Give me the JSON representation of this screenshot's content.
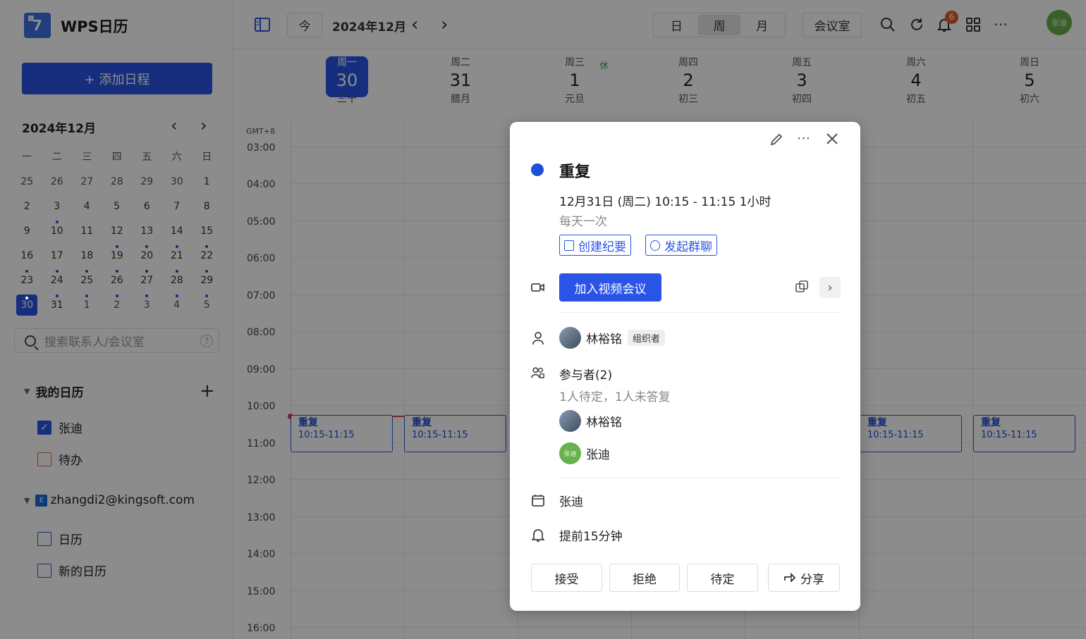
{
  "sidebar": {
    "app_title": "WPS日历",
    "logo_glyph": "7",
    "add_button": "+ 添加日程",
    "mini_month_title": "2024年12月",
    "weekday_headers": [
      "一",
      "二",
      "三",
      "四",
      "五",
      "六",
      "日"
    ],
    "weeks": [
      [
        "25",
        "26",
        "27",
        "28",
        "29",
        "30",
        "1"
      ],
      [
        "2",
        "3",
        "4",
        "5",
        "6",
        "7",
        "8"
      ],
      [
        "9",
        "10",
        "11",
        "12",
        "13",
        "14",
        "15"
      ],
      [
        "16",
        "17",
        "18",
        "19",
        "20",
        "21",
        "22"
      ],
      [
        "23",
        "24",
        "25",
        "26",
        "27",
        "28",
        "29"
      ],
      [
        "30",
        "31",
        "1",
        "2",
        "3",
        "4",
        "5"
      ]
    ],
    "search_placeholder": "搜索联系人/会议室",
    "help_glyph": "?",
    "my_calendars_title": "我的日历",
    "my_calendars": [
      {
        "label": "张迪",
        "checked": true
      },
      {
        "label": "待办",
        "checked": false
      }
    ],
    "account_title": "zhangdi2@kingsoft.com",
    "account_calendars": [
      {
        "label": "日历",
        "checked": false
      },
      {
        "label": "新的日历",
        "checked": false
      }
    ]
  },
  "topbar": {
    "today_button": "今",
    "current_month": "2024年12月",
    "views": [
      "日",
      "周",
      "月"
    ],
    "active_view": "周",
    "meeting_room_button": "会议室",
    "notification_count": "6",
    "user_avatar_text": "张迪"
  },
  "week": {
    "days": [
      {
        "weekday": "周一",
        "date": "30",
        "lunar": "三十",
        "today": true
      },
      {
        "weekday": "周二",
        "date": "31",
        "lunar": "腊月",
        "today": false
      },
      {
        "weekday": "周三",
        "date": "1",
        "lunar": "元旦",
        "today": false
      },
      {
        "weekday": "周四",
        "date": "2",
        "lunar": "初三",
        "today": false
      },
      {
        "weekday": "周五",
        "date": "3",
        "lunar": "初四",
        "today": false
      },
      {
        "weekday": "周六",
        "date": "4",
        "lunar": "初五",
        "today": false
      },
      {
        "weekday": "周日",
        "date": "5",
        "lunar": "初六",
        "today": false
      }
    ],
    "holiday_tag": "休",
    "timezone": "GMT+8",
    "hours": [
      "03:00",
      "04:00",
      "05:00",
      "06:00",
      "07:00",
      "08:00",
      "09:00",
      "10:00",
      "11:00",
      "12:00",
      "13:00",
      "14:00",
      "15:00",
      "16:00"
    ],
    "events": [
      {
        "title": "重复",
        "time": "10:15-11:15"
      },
      {
        "title": "重复",
        "time": "10:15-11:15"
      },
      {
        "title": "重复",
        "time": "10:15-11:15"
      },
      {
        "title": "重复",
        "time": "10:15-11:15"
      }
    ]
  },
  "popup": {
    "title": "重复",
    "time": "12月31日 (周二) 10:15 - 11:15 1小时",
    "repeat": "每天一次",
    "create_minutes": "创建纪要",
    "start_group_chat": "发起群聊",
    "join_video": "加入视频会议",
    "organizer_name": "林裕铭",
    "organizer_tag": "组织者",
    "participants_title": "参与者(2)",
    "participants_status": "1人待定，1人未答复",
    "participants": [
      {
        "name": "林裕铭",
        "avatar": ""
      },
      {
        "name": "张迪",
        "avatar": "张迪"
      }
    ],
    "calendar_name": "张迪",
    "reminder": "提前15分钟",
    "accept": "接受",
    "decline": "拒绝",
    "tentative": "待定",
    "share": "分享"
  },
  "colors": {
    "accent": "#2a54e5",
    "holiday": "#3aa84b",
    "badge": "#e15a2b",
    "now_line": "#e23b3b"
  }
}
